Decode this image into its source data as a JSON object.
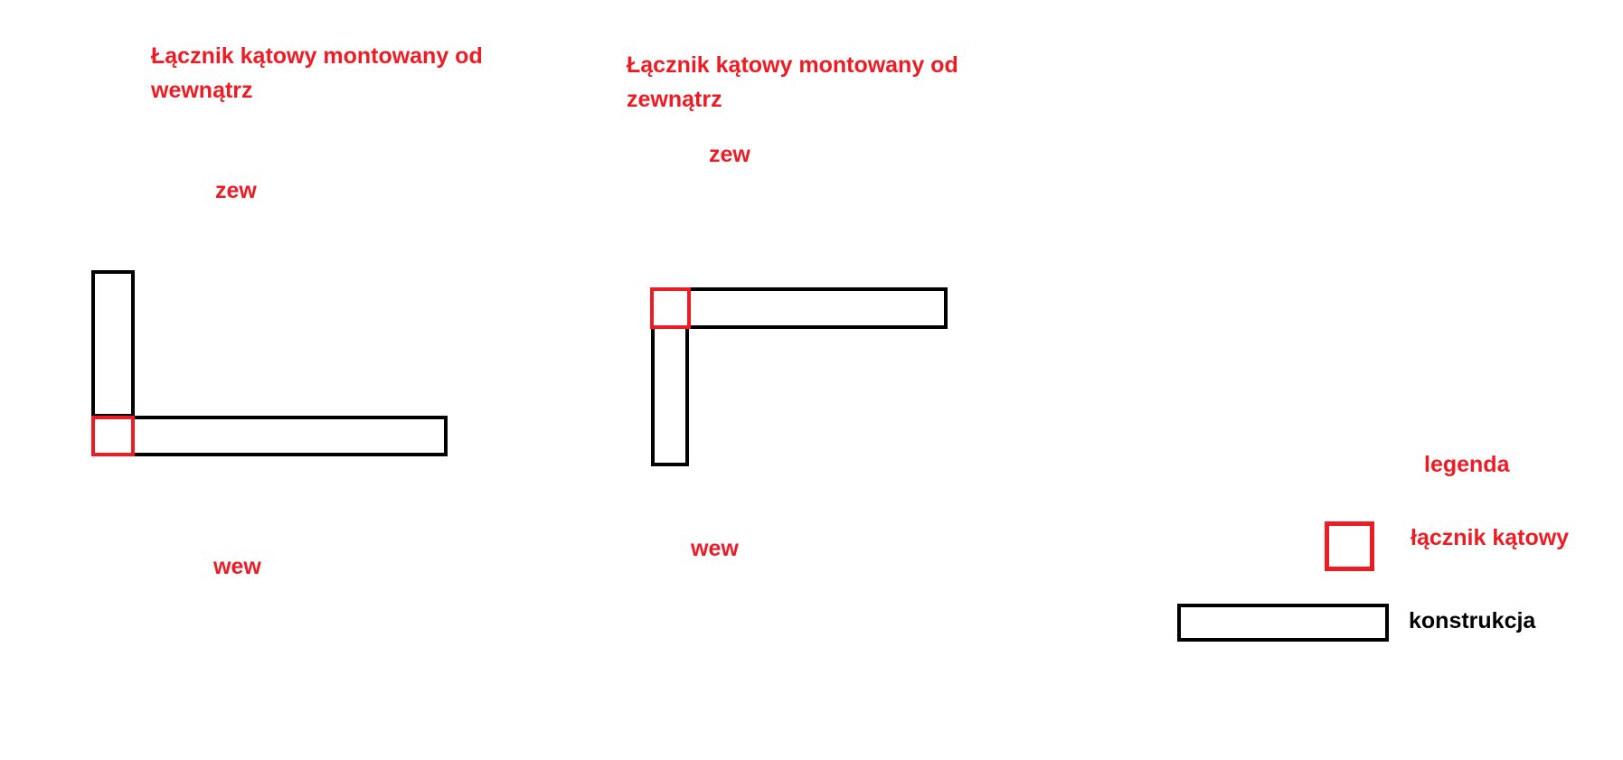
{
  "left_diagram": {
    "title_line1": "Łącznik kątowy montowany od",
    "title_line2": "wewnątrz",
    "label_top": "zew",
    "label_bottom": "wew"
  },
  "right_diagram": {
    "title_line1": "Łącznik kątowy montowany od",
    "title_line2": "zewnątrz",
    "label_top": "zew",
    "label_bottom": "wew"
  },
  "legend": {
    "title": "legenda",
    "connector_label": "łącznik kątowy",
    "construction_label": "konstrukcja"
  },
  "colors": {
    "connector": "#ed1c24",
    "construction": "#000000",
    "text_accent": "#ed1c24"
  }
}
